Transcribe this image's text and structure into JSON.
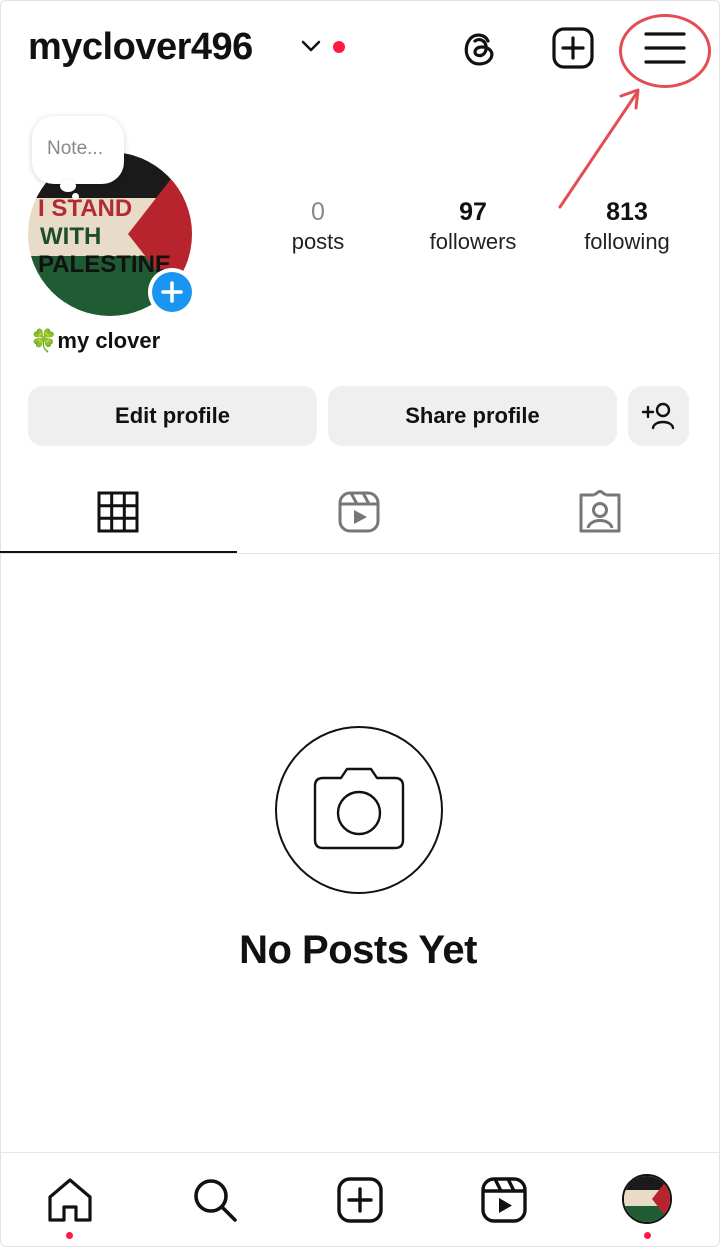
{
  "header": {
    "username": "myclover496",
    "icons": [
      "chevron-down-icon",
      "threads-icon",
      "new-post-icon",
      "menu-icon"
    ],
    "notification_color": "#ff1a44"
  },
  "annotation": {
    "color": "#e24e52"
  },
  "profile": {
    "note_placeholder": "Note...",
    "avatar_text": [
      "I STAND",
      "WITH",
      "PALESTINE"
    ],
    "bio_name": "my clover",
    "bio_emoji": "🍀",
    "stats": [
      {
        "value": "0",
        "label": "posts"
      },
      {
        "value": "97",
        "label": "followers"
      },
      {
        "value": "813",
        "label": "following"
      }
    ]
  },
  "actions": {
    "edit_label": "Edit profile",
    "share_label": "Share profile"
  },
  "tabs": [
    {
      "icon": "grid-icon",
      "active": true
    },
    {
      "icon": "reels-icon",
      "active": false
    },
    {
      "icon": "tagged-icon",
      "active": false
    }
  ],
  "empty_state": {
    "title": "No Posts Yet",
    "icon": "camera-icon"
  },
  "bottom_nav": {
    "items": [
      "home-icon",
      "search-icon",
      "create-icon",
      "reels-icon",
      "profile-avatar"
    ],
    "accent": "#ff1a44"
  }
}
